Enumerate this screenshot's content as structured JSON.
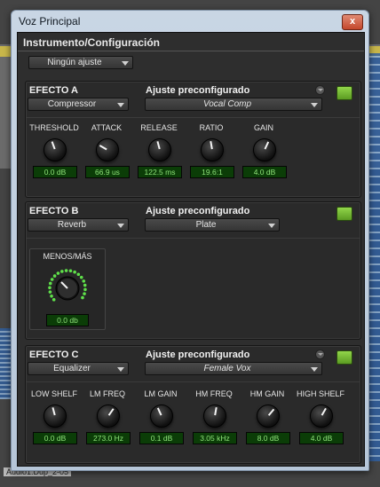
{
  "window": {
    "title": "Voz Principal",
    "close": "x"
  },
  "header": {
    "title": "Instrumento/Configuración",
    "preset": "Ningún ajuste"
  },
  "background": {
    "clip_label": "Audio1.Dup_2-05"
  },
  "colors": {
    "led_on": "#7cc43a",
    "readout_text": "#8fe37a",
    "readout_bg": "#0b3d07",
    "panel": "#2a2a2a"
  },
  "effect_a": {
    "title": "EFECTO A",
    "preset_label": "Ajuste preconfigurado",
    "plugin": "Compressor",
    "preset": "Vocal Comp",
    "knobs": [
      {
        "label": "THRESHOLD",
        "value": "0.0 dB"
      },
      {
        "label": "ATTACK",
        "value": "66.9 us"
      },
      {
        "label": "RELEASE",
        "value": "122.5 ms"
      },
      {
        "label": "RATIO",
        "value": "19.6:1"
      },
      {
        "label": "GAIN",
        "value": "4.0 dB"
      }
    ]
  },
  "effect_b": {
    "title": "EFECTO B",
    "preset_label": "Ajuste preconfigurado",
    "plugin": "Reverb",
    "preset": "Plate",
    "knob": {
      "label": "MENOS/MÁS",
      "value": "0.0 db"
    }
  },
  "effect_c": {
    "title": "EFECTO C",
    "preset_label": "Ajuste preconfigurado",
    "plugin": "Equalizer",
    "preset": "Female Vox",
    "knobs": [
      {
        "label": "LOW SHELF",
        "value": "0.0 dB"
      },
      {
        "label": "LM FREQ",
        "value": "273.0 Hz"
      },
      {
        "label": "LM GAIN",
        "value": "0.1 dB"
      },
      {
        "label": "HM FREQ",
        "value": "3.05 kHz"
      },
      {
        "label": "HM GAIN",
        "value": "8.0 dB"
      },
      {
        "label": "HIGH SHELF",
        "value": "4.0 dB"
      }
    ]
  }
}
